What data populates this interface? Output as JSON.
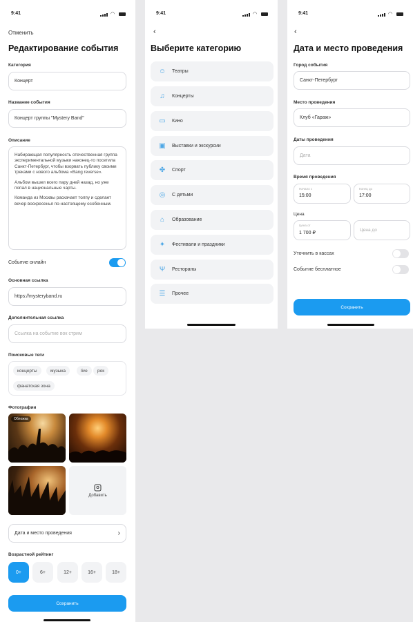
{
  "status": {
    "time": "9:41"
  },
  "screen1": {
    "cancel": "Отменить",
    "title": "Редактирование события",
    "category_label": "Категория",
    "category_value": "Концерт",
    "name_label": "Название события",
    "name_value": "Концерт группы \"Mystery Band\"",
    "description_label": "Описание",
    "description_paragraphs": [
      "Набирающая популярность отечественная группа экспериментальной музыки наконец-то посетила Санкт-Петербург, чтобы взорвать публику своими треками с нового альбома «Bang reverse».",
      "Альбом вышел всего пару дней назад, но уже попал в национальные чарты.",
      "Команда из Москвы раскачает толпу и сделает вечер воскресенья по-настоящему особенным."
    ],
    "online_label": "Событие онлайн",
    "online_enabled": true,
    "main_link_label": "Основная ссылка",
    "main_link_value": "https://mysteryband.ru",
    "extra_link_label": "Дополнительная ссылка",
    "extra_link_placeholder": "Ссылка на событие вок стрим",
    "tags_label": "Поисковые теги",
    "tags": [
      "концерты",
      "музыка",
      "live",
      "рок",
      "фанатская зона"
    ],
    "photos_label": "Фотографии",
    "cover_badge": "Обложка",
    "add_photo": "Добавить",
    "date_place_button": "Дата и место проведения",
    "age_label": "Возрастной рейтинг",
    "ages": [
      "0+",
      "6+",
      "12+",
      "16+",
      "18+"
    ],
    "age_selected": "0+",
    "save": "Сохранить"
  },
  "screen2": {
    "title": "Выберите категорию",
    "categories": [
      {
        "label": "Театры",
        "icon": "theater-icon"
      },
      {
        "label": "Концерты",
        "icon": "music-icon"
      },
      {
        "label": "Кино",
        "icon": "film-icon"
      },
      {
        "label": "Выставки и экскурсии",
        "icon": "gallery-icon"
      },
      {
        "label": "Спорт",
        "icon": "sport-icon"
      },
      {
        "label": "С детьми",
        "icon": "kids-icon"
      },
      {
        "label": "Образование",
        "icon": "education-icon"
      },
      {
        "label": "Фестивали и праздники",
        "icon": "festival-icon"
      },
      {
        "label": "Рестораны",
        "icon": "restaurant-icon"
      },
      {
        "label": "Прочее",
        "icon": "other-icon"
      }
    ]
  },
  "screen3": {
    "title": "Дата и место проведения",
    "city_label": "Город события",
    "city_value": "Санкт-Петербург",
    "place_label": "Место проведения",
    "place_value": "Клуб «Гараж»",
    "dates_label": "Даты проведения",
    "dates_placeholder": "Дата",
    "time_label": "Время проведения",
    "time_from_caption": "Начало с",
    "time_from": "15:00",
    "time_to_caption": "Конец до",
    "time_to": "17:00",
    "price_label": "Цена",
    "price_from_caption": "Цена от",
    "price_from": "1 700 ₽",
    "price_to_placeholder": "Цена до",
    "clarify_label": "Уточнить в кассах",
    "free_label": "Событие бесплатное",
    "save": "Сохранить"
  },
  "colors": {
    "accent": "#1b9bf0",
    "background": "#e9e9eb",
    "card": "#f2f3f5"
  }
}
